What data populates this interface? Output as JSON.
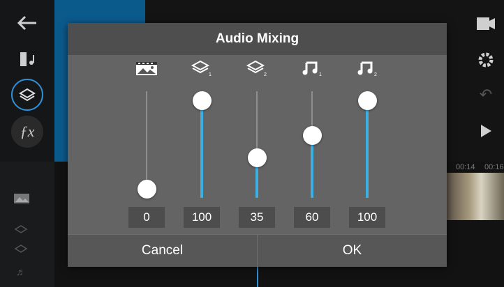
{
  "dialog": {
    "title": "Audio Mixing",
    "cancel_label": "Cancel",
    "ok_label": "OK",
    "channels": [
      {
        "icon": "video-clip-icon",
        "value": 0,
        "label": "0"
      },
      {
        "icon": "layer-1-icon",
        "value": 100,
        "label": "100"
      },
      {
        "icon": "layer-2-icon",
        "value": 35,
        "label": "35"
      },
      {
        "icon": "music-1-icon",
        "value": 60,
        "label": "60"
      },
      {
        "icon": "music-2-icon",
        "value": 100,
        "label": "100"
      }
    ]
  },
  "timeline": {
    "ruler_times": [
      "00:14",
      "00:16"
    ]
  },
  "colors": {
    "accent": "#3db0e3",
    "dialog_bg": "#646464",
    "title_bg": "#4e4e4e",
    "value_box": "#4d4d4d"
  }
}
